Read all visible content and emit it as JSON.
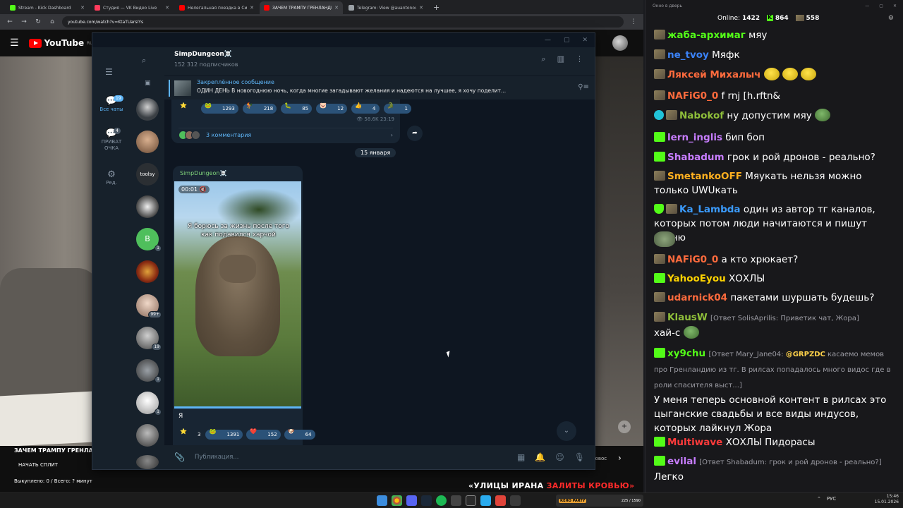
{
  "browser": {
    "tabs": [
      {
        "title": "Stream - Kick Dashboard",
        "color": "#53fc18",
        "active": false
      },
      {
        "title": "Студия — VK Видео Live",
        "color": "#ff3b5c",
        "active": false
      },
      {
        "title": "Нелегальная поездка в Сирию",
        "color": "#ff0000",
        "active": false
      },
      {
        "title": "ЗАЧЕМ ТРАМПУ ГРЕНЛАНДИЯ",
        "color": "#ff0000",
        "active": true
      },
      {
        "title": "Telegram: View @auantonov",
        "color": "#9aa0a6",
        "active": false
      }
    ],
    "new_tab": "+",
    "url": "youtube.com/watch?v=KtaTUarsIYs"
  },
  "youtube": {
    "logo": "YouTube",
    "logo_region": "RU",
    "video_title": "ЗАЧЕМ ТРАМПУ ГРЕНЛАН",
    "split_button": "НАЧАТЬ СПЛИТ",
    "bought_info": "Выкуплено: 0 / Всего: ? минут",
    "right_fragment": "ювос",
    "ticker_white": "«УЛИЦЫ ИРАНА ",
    "ticker_red": "ЗАЛИТЫ КРОВЬЮ»"
  },
  "telegram": {
    "folders": [
      {
        "label": "Все чаты",
        "badge": "19",
        "icon": "chat-bubble-icon",
        "active": true
      },
      {
        "label": "ПРИВАТ ОЧКА",
        "badge": "4",
        "icon": "chat-bubble-icon",
        "active": false
      },
      {
        "label": "Ред.",
        "badge": "",
        "icon": "edit-sliders-icon",
        "active": false
      }
    ],
    "chat_list": [
      {
        "label": "",
        "badge": "",
        "color": "#3a3f44"
      },
      {
        "label": "",
        "badge": "",
        "color": "#a0765a"
      },
      {
        "label": "toolsy",
        "badge": "",
        "color": "#2b2f33"
      },
      {
        "label": "",
        "badge": "",
        "color": "#d7d7d7"
      },
      {
        "label": "B",
        "badge": "1",
        "color": "#4fbf5c"
      },
      {
        "label": "",
        "badge": "",
        "color": "#8a2b12"
      },
      {
        "label": "",
        "badge": "99+",
        "color": "#b99a86"
      },
      {
        "label": "",
        "badge": "19",
        "color": "#6a6f75"
      },
      {
        "label": "",
        "badge": "1",
        "color": "#4a4f55"
      },
      {
        "label": "",
        "badge": "1",
        "color": "#dcdcdc"
      },
      {
        "label": "",
        "badge": "",
        "color": "#6b6b6b"
      }
    ],
    "channel_name": "SimpDungeon☠️",
    "subscribers": "152 312 подписчиков",
    "pinned_title": "Закреплённое сообщение",
    "pinned_text": "ОДИН ДЕНЬ  В новогоднюю ночь, когда многие загадывают желания и надеются на лучшее, я хочу поделит...",
    "reactions1": [
      {
        "emoji": "⭐",
        "count": ""
      },
      {
        "emoji": "🐸",
        "count": "1293"
      },
      {
        "emoji": "🐓",
        "count": "218"
      },
      {
        "emoji": "🐛",
        "count": "85"
      },
      {
        "emoji": "🐷",
        "count": "12"
      },
      {
        "emoji": "👍",
        "count": "4"
      },
      {
        "emoji": "🐊",
        "count": "1"
      }
    ],
    "views": "58.6K",
    "time": "23:19",
    "comments": "3 комментария",
    "date_divider": "15 января",
    "post_author": "SimpDungeon☠️",
    "video_time": "00:01",
    "video_caption": "Я борюсь за жизнь после того как подавился харчой",
    "post_text": "Я",
    "reactions2": [
      {
        "emoji": "⭐",
        "count": "3"
      },
      {
        "emoji": "🐸",
        "count": "1391"
      },
      {
        "emoji": "❤️",
        "count": "152"
      },
      {
        "emoji": "🐶",
        "count": "64"
      }
    ],
    "composer_placeholder": "Публикация..."
  },
  "chat": {
    "window_title": "Окно в дверь",
    "online_label": "Online:",
    "online_count": "1422",
    "kick_count": "864",
    "other_count": "558",
    "messages": [
      {
        "badge": "vip",
        "user": "жаба-архимаг",
        "color": "#53fc18",
        "text": "мяу"
      },
      {
        "badge": "vip",
        "user": "ne_tvoy",
        "color": "#3b82f6",
        "text": "Мяфк"
      },
      {
        "badge": "vip",
        "user": "Ляксей Михалыч",
        "color": "#ff6b3d",
        "text": ""
      },
      {
        "badge": "vip",
        "user": "NAFiG0_0",
        "color": "#ff6b3d",
        "text": "f rnj [h.rftn&"
      },
      {
        "badge": "ver",
        "user": "Nabokof",
        "color": "#8fbf3a",
        "text": "ну допустим мяу"
      },
      {
        "badge": "mod",
        "user": "lern_inglis",
        "color": "#c77dff",
        "text": "бип боп"
      },
      {
        "badge": "mod",
        "user": "Shabadum",
        "color": "#c77dff",
        "text": "грок и рой дронов - реально?"
      },
      {
        "badge": "vip",
        "user": "SmetankoOFF",
        "color": "#ffb020",
        "text": "Мяукать нельзя можно только UWUкать"
      },
      {
        "badge": "shield",
        "user": "Ka_Lambda",
        "color": "#3b9cff",
        "text": "один из автор тг каналов, которых потом люди начитаются и пишут хуйню"
      },
      {
        "badge": "vip",
        "user": "NAFiG0_0",
        "color": "#ff6b3d",
        "text": "а кто хрюкает?"
      },
      {
        "badge": "mod",
        "user": "YahooEyou",
        "color": "#ffd400",
        "text": "ХОХЛЫ"
      },
      {
        "badge": "vip",
        "user": "udarnick04",
        "color": "#ff6b3d",
        "text": "пакетами шуршать будешь?"
      },
      {
        "badge": "vip",
        "user": "KlausW",
        "color": "#8fbf3a",
        "reply": "[Ответ SolisAprilis: Приветик чат, Жора]",
        "text": "хай-с"
      },
      {
        "badge": "mod",
        "user": "xy9chu",
        "color": "#53fc18",
        "reply": "[Ответ Mary_Jane04: @GRPZDC касаемо мемов про Гренландию из тг. В рилсах попадалось много видос где в роли спасителя выст...]",
        "mention": "@GRPZDC",
        "text": "У меня теперь основной контент в рилсах это цыганские свадьбы и все виды индусов, которых лайкнул Жора"
      },
      {
        "badge": "mod",
        "user": "Multiwave",
        "color": "#ff3b3b",
        "text": "ХОХЛЫ Пидорасы"
      },
      {
        "badge": "mod",
        "user": "evilal",
        "color": "#c77dff",
        "reply": "[Ответ Shabadum: грок и рой дронов - реально?]",
        "text": "Легко"
      }
    ]
  },
  "taskbar": {
    "game_label": "КЕНО PARTY",
    "game_counter": "225 / 1590",
    "lang": "РУС",
    "time": "15:46",
    "date": "15.01.2026"
  }
}
